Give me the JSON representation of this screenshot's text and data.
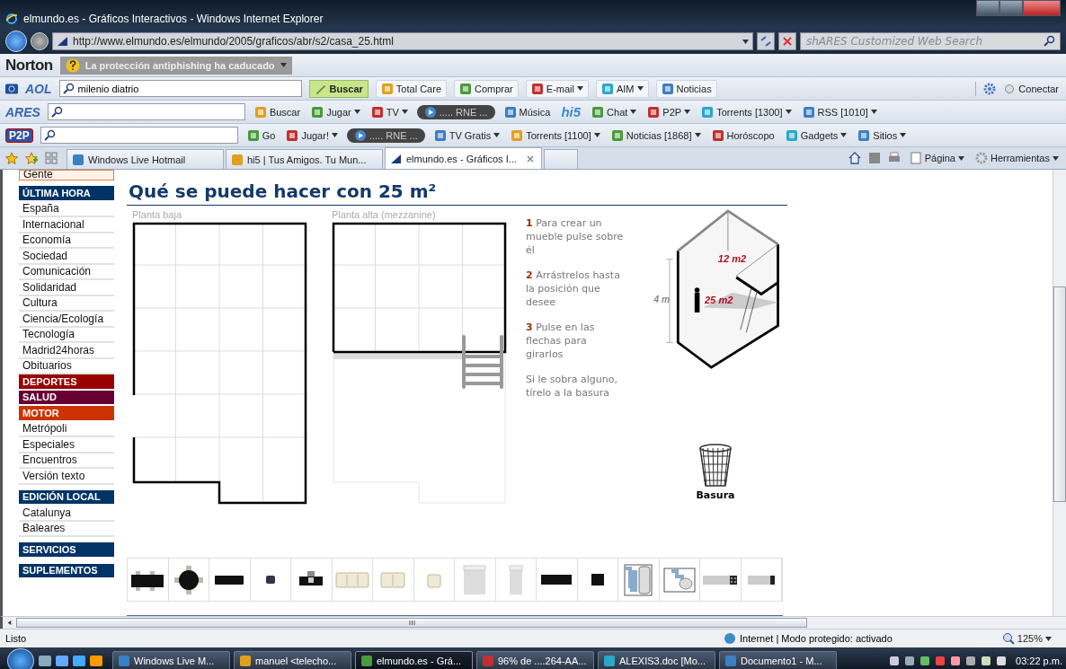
{
  "window": {
    "title": "elmundo.es - Gráficos Interactivos - Windows Internet Explorer"
  },
  "address_bar": {
    "url": "http://www.elmundo.es/elmundo/2005/graficos/abr/s2/casa_25.html",
    "search_placeholder": "shARES Customized Web Search"
  },
  "norton_bar": {
    "logo": "Norton",
    "message": "La protección antiphishing ha caducado"
  },
  "toolbars": [
    {
      "brand": "AOL",
      "search_value": "milenio diatrio",
      "items": [
        {
          "label": "Buscar",
          "kind": "search"
        },
        {
          "label": "Total Care",
          "kind": "button",
          "menu": false
        },
        {
          "label": "Comprar",
          "kind": "button",
          "menu": false
        },
        {
          "label": "E-mail",
          "kind": "button",
          "menu": true
        },
        {
          "label": "AIM",
          "kind": "button",
          "menu": true
        },
        {
          "label": "Noticias",
          "kind": "button",
          "menu": false
        }
      ],
      "right": "Conectar"
    },
    {
      "brand": "ARES",
      "items": [
        {
          "label": "Buscar",
          "kind": "plain",
          "menu": false
        },
        {
          "label": "Jugar",
          "kind": "plain",
          "menu": true
        },
        {
          "label": "TV",
          "kind": "plain",
          "menu": true
        },
        {
          "label": "..... RNE ...",
          "kind": "player"
        },
        {
          "label": "Música",
          "kind": "plain",
          "menu": false
        },
        {
          "label": "hi5",
          "kind": "logo"
        },
        {
          "label": "Chat",
          "kind": "plain",
          "menu": true
        },
        {
          "label": "P2P",
          "kind": "plain",
          "menu": true
        },
        {
          "label": "Torrents [1300]",
          "kind": "plain",
          "menu": true
        },
        {
          "label": "RSS [1010]",
          "kind": "plain",
          "menu": true
        }
      ]
    },
    {
      "brand": "P2P",
      "items": [
        {
          "label": "Go",
          "kind": "plain",
          "menu": false
        },
        {
          "label": "Jugar!",
          "kind": "plain",
          "menu": true
        },
        {
          "label": "..... RNE ...",
          "kind": "player"
        },
        {
          "label": "TV Gratis",
          "kind": "plain",
          "menu": true
        },
        {
          "label": "Torrents [1100]",
          "kind": "plain",
          "menu": true
        },
        {
          "label": "Noticias [1868]",
          "kind": "plain",
          "menu": true
        },
        {
          "label": "Horóscopo",
          "kind": "plain",
          "menu": false
        },
        {
          "label": "Gadgets",
          "kind": "plain",
          "menu": true
        },
        {
          "label": "Sitios",
          "kind": "plain",
          "menu": true
        }
      ]
    }
  ],
  "tabs": [
    {
      "label": "Windows Live Hotmail",
      "selected": false
    },
    {
      "label": "hi5 | Tus Amigos. Tu Mun...",
      "selected": false
    },
    {
      "label": "elmundo.es - Gráficos I...",
      "selected": true
    }
  ],
  "commands": [
    {
      "label": "Página",
      "menu": true
    },
    {
      "label": "Herramientas",
      "menu": true
    }
  ],
  "sidebar": {
    "groups": [
      {
        "items": [
          {
            "label": "Gente",
            "kind": "boxed"
          }
        ]
      },
      {
        "items": [
          {
            "label": "ÚLTIMA HORA",
            "kind": "header",
            "color": "#003366"
          },
          {
            "label": "España",
            "kind": "link"
          },
          {
            "label": "Internacional",
            "kind": "link"
          },
          {
            "label": "Economía",
            "kind": "link"
          },
          {
            "label": "Sociedad",
            "kind": "link"
          },
          {
            "label": "Comunicación",
            "kind": "link"
          },
          {
            "label": "Solidaridad",
            "kind": "link"
          },
          {
            "label": "Cultura",
            "kind": "link"
          },
          {
            "label": "Ciencia/Ecología",
            "kind": "link"
          },
          {
            "label": "Tecnología",
            "kind": "link"
          },
          {
            "label": "Madrid24horas",
            "kind": "link"
          },
          {
            "label": "Obituarios",
            "kind": "link"
          },
          {
            "label": "DEPORTES",
            "kind": "header",
            "color": "#990000"
          },
          {
            "label": "SALUD",
            "kind": "header",
            "color": "#660033"
          },
          {
            "label": "MOTOR",
            "kind": "header",
            "color": "#cc3300"
          },
          {
            "label": "Metrópoli",
            "kind": "link"
          },
          {
            "label": "Especiales",
            "kind": "link"
          },
          {
            "label": "Encuentros",
            "kind": "link"
          },
          {
            "label": "Versión texto",
            "kind": "link"
          }
        ]
      },
      {
        "items": [
          {
            "label": "EDICIÓN LOCAL",
            "kind": "header",
            "color": "#003366"
          },
          {
            "label": "Catalunya",
            "kind": "link"
          },
          {
            "label": "Baleares",
            "kind": "link"
          }
        ]
      },
      {
        "items": [
          {
            "label": "SERVICIOS",
            "kind": "header",
            "color": "#003366"
          }
        ]
      },
      {
        "items": [
          {
            "label": "SUPLEMENTOS",
            "kind": "header",
            "color": "#003366"
          }
        ]
      }
    ]
  },
  "content": {
    "title": "Qué se puede hacer con 25 m²",
    "plans": [
      {
        "label": "Planta baja",
        "kind": "ground"
      },
      {
        "label": "Planta alta (mezzanine)",
        "kind": "upper"
      }
    ],
    "steps": [
      {
        "number": "1",
        "text": "Para crear un mueble pulse sobre él"
      },
      {
        "number": "2",
        "text": "Arrástrelos hasta la posición que desee"
      },
      {
        "number": "3",
        "text": "Pulse en las flechas para girarlos"
      }
    ],
    "note": "Si le sobra alguno, tírelo a la basura",
    "model": {
      "upper_area": "12 m2",
      "lower_area": "25 m2",
      "height": "4 m"
    },
    "trash_label": "Basura",
    "palette": [
      {
        "kind": "dining-table"
      },
      {
        "kind": "round-table"
      },
      {
        "kind": "bench"
      },
      {
        "kind": "stool"
      },
      {
        "kind": "desk"
      },
      {
        "kind": "sofa-3"
      },
      {
        "kind": "sofa-2"
      },
      {
        "kind": "armchair"
      },
      {
        "kind": "bed-double"
      },
      {
        "kind": "bed-single"
      },
      {
        "kind": "cabinet"
      },
      {
        "kind": "cabinet-small"
      },
      {
        "kind": "bathroom"
      },
      {
        "kind": "bathroom-small"
      },
      {
        "kind": "kitchen"
      },
      {
        "kind": "kitchen-small"
      }
    ]
  },
  "status_bar": {
    "text": "Listo",
    "zone": "Internet | Modo protegido: activado",
    "zoom": "125%"
  },
  "taskbar": {
    "buttons": [
      {
        "label": "Windows Live M...",
        "selected": false
      },
      {
        "label": "manuel <telecho...",
        "selected": false
      },
      {
        "label": "elmundo.es - Grá...",
        "selected": true
      },
      {
        "label": "96% de ....264-AA...",
        "selected": false
      },
      {
        "label": "ALEXIS3.doc [Mo...",
        "selected": false
      },
      {
        "label": "Documento1 - M...",
        "selected": false
      }
    ],
    "clock": "03:22 p.m."
  }
}
